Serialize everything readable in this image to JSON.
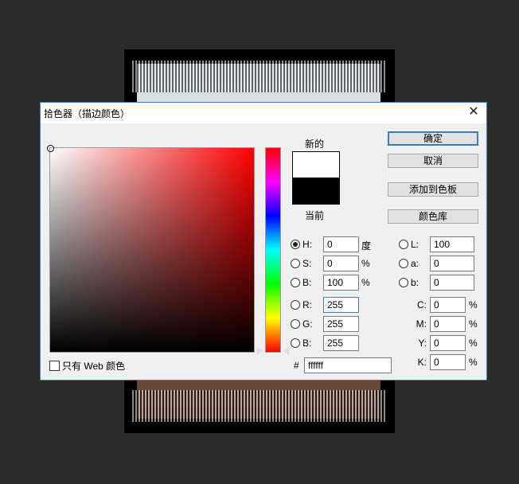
{
  "dialog": {
    "title": "拾色器（描边颜色）",
    "close_glyph": "✕"
  },
  "preview": {
    "new_label": "新的",
    "current_label": "当前",
    "new_color": "#ffffff",
    "current_color": "#000000"
  },
  "buttons": {
    "ok": "确定",
    "cancel": "取消",
    "add_swatch": "添加到色板",
    "color_library": "颜色库"
  },
  "hsb": {
    "h_label": "H:",
    "h_value": "0",
    "h_unit": "度",
    "s_label": "S:",
    "s_value": "0",
    "s_unit": "%",
    "b_label": "B:",
    "b_value": "100",
    "b_unit": "%"
  },
  "rgb": {
    "r_label": "R:",
    "r_value": "255",
    "g_label": "G:",
    "g_value": "255",
    "b_label": "B:",
    "b_value": "255"
  },
  "lab": {
    "l_label": "L:",
    "l_value": "100",
    "a_label": "a:",
    "a_value": "0",
    "b_label": "b:",
    "b_value": "0"
  },
  "cmyk": {
    "c_label": "C:",
    "c_value": "0",
    "c_unit": "%",
    "m_label": "M:",
    "m_value": "0",
    "m_unit": "%",
    "y_label": "Y:",
    "y_value": "0",
    "y_unit": "%",
    "k_label": "K:",
    "k_value": "0",
    "k_unit": "%"
  },
  "hex": {
    "label": "#",
    "value": "ffffff"
  },
  "web_only_label": "只有 Web 颜色",
  "selected_mode": "H",
  "accent_color": "#3c7fb1"
}
